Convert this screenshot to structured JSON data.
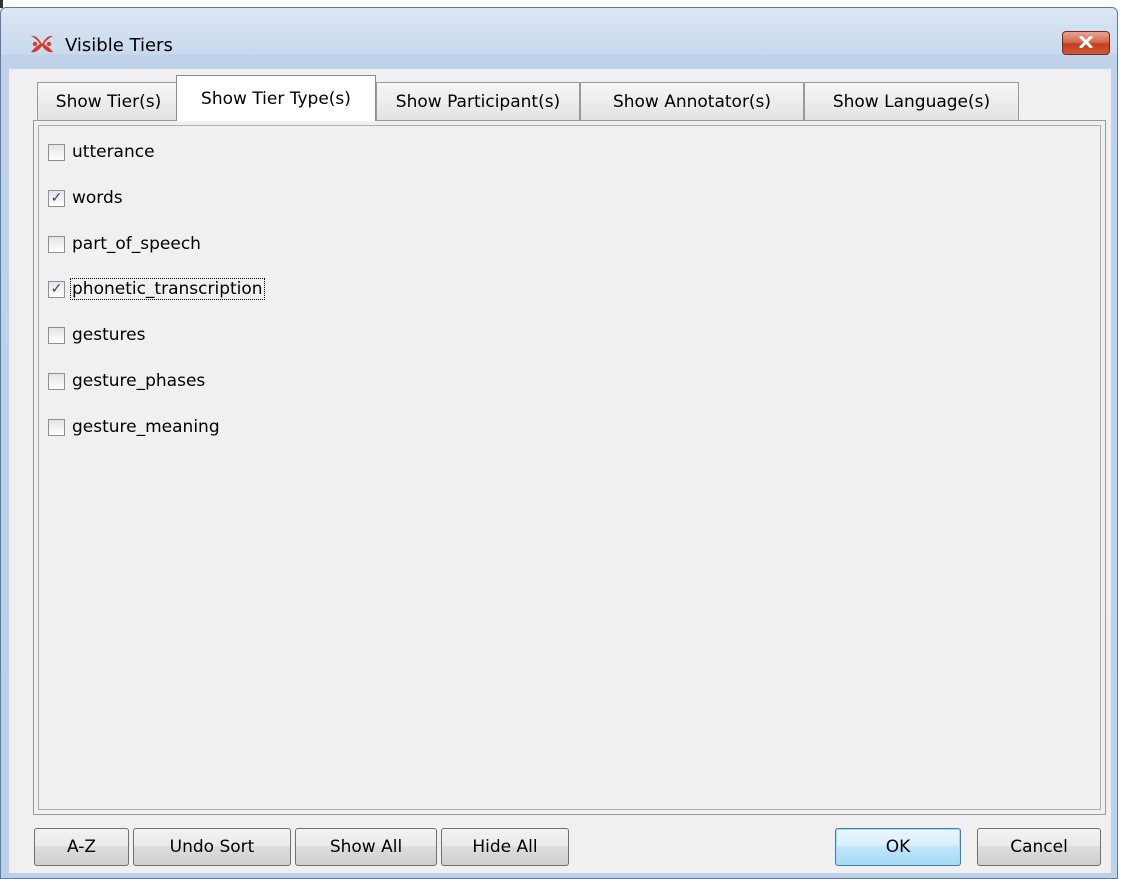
{
  "window": {
    "title": "Visible Tiers",
    "app_icon": "elan-logo-icon",
    "close_icon": "close-icon"
  },
  "tabs": [
    {
      "label": "Show Tier(s)",
      "active": false
    },
    {
      "label": "Show Tier Type(s)",
      "active": true
    },
    {
      "label": "Show Participant(s)",
      "active": false
    },
    {
      "label": "Show Annotator(s)",
      "active": false
    },
    {
      "label": "Show Language(s)",
      "active": false
    }
  ],
  "tier_types": [
    {
      "label": "utterance",
      "checked": false
    },
    {
      "label": "words",
      "checked": true
    },
    {
      "label": "part_of_speech",
      "checked": false
    },
    {
      "label": "phonetic_transcription",
      "checked": true,
      "focused": true
    },
    {
      "label": "gestures",
      "checked": false
    },
    {
      "label": "gesture_phases",
      "checked": false
    },
    {
      "label": "gesture_meaning",
      "checked": false
    }
  ],
  "buttons": {
    "sort_az": "A-Z",
    "undo_sort": "Undo Sort",
    "show_all": "Show All",
    "hide_all": "Hide All",
    "ok": "OK",
    "cancel": "Cancel"
  },
  "colors": {
    "title_bar": "#c9d9ee",
    "close_button": "#c2401f",
    "checkmark": "#1f3f8c"
  }
}
